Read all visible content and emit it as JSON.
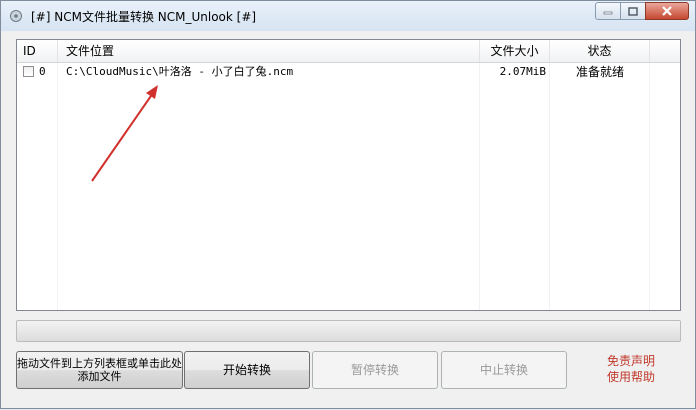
{
  "window": {
    "title": "[#] NCM文件批量转换 NCM_Unlook [#]"
  },
  "colors": {
    "accent_red": "#d0312d",
    "help_text": "#c0392b",
    "progress_fill": "#06b025"
  },
  "list": {
    "columns": [
      {
        "key": "id",
        "label": "ID"
      },
      {
        "key": "path",
        "label": "文件位置"
      },
      {
        "key": "size",
        "label": "文件大小"
      },
      {
        "key": "status",
        "label": "状态"
      }
    ],
    "rows": [
      {
        "checked": false,
        "id": "0",
        "path": "C:\\CloudMusic\\叶洛洛 - 小了白了兔.ncm",
        "size": "2.07MiB",
        "status": "准备就绪"
      }
    ]
  },
  "progress": {
    "percent": 0
  },
  "buttons": {
    "add_files": "拖动文件到上方列表框或单击此处添加文件",
    "start": "开始转换",
    "pause": "暂停转换",
    "stop": "中止转换"
  },
  "help": {
    "line1": "免责声明",
    "line2": "使用帮助"
  },
  "icons": {
    "app": "app-icon",
    "minimize": "minimize-icon",
    "maximize": "maximize-icon",
    "close": "close-icon"
  }
}
